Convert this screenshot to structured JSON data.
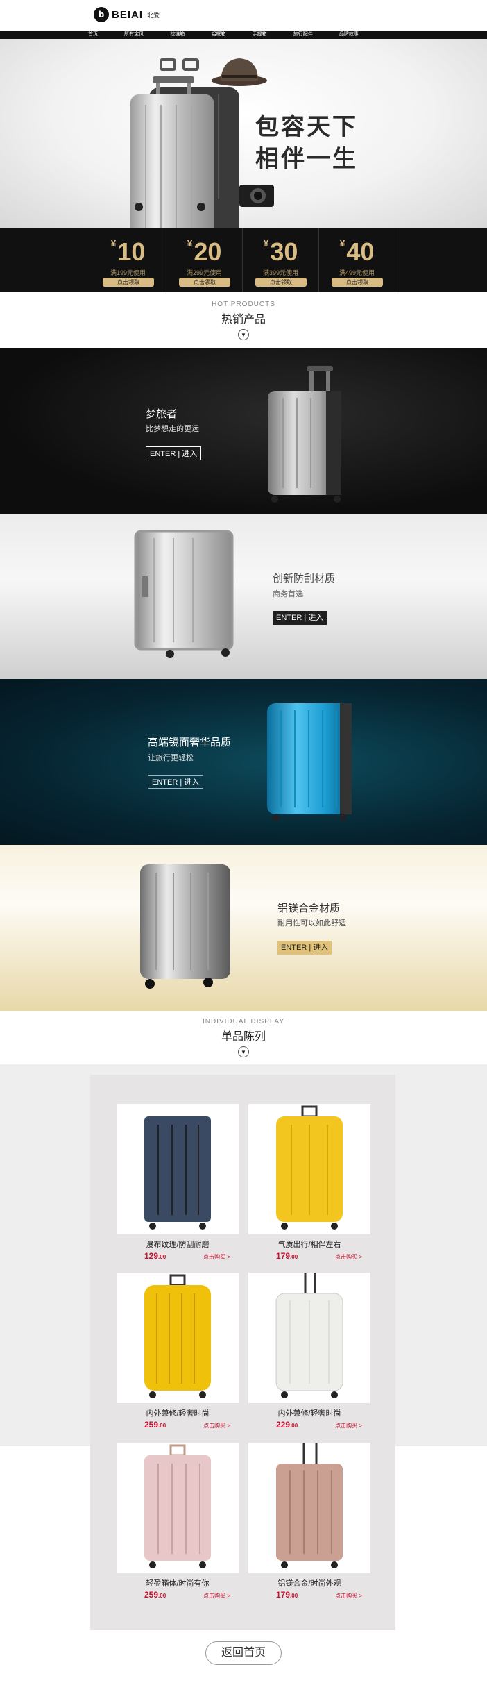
{
  "brand": {
    "logo_text": "BEIAI",
    "logo_sub": "北爱"
  },
  "nav": [
    "首页",
    "所有宝贝",
    "拉链箱",
    "铝框箱",
    "手提箱",
    "旅行配件",
    "品牌故事"
  ],
  "hero": {
    "line1": "包容天下",
    "line2": "相伴一生"
  },
  "coupons": [
    {
      "amount": "10",
      "condition": "满199元使用",
      "button": "点击领取"
    },
    {
      "amount": "20",
      "condition": "满299元使用",
      "button": "点击领取"
    },
    {
      "amount": "30",
      "condition": "满399元使用",
      "button": "点击领取"
    },
    {
      "amount": "40",
      "condition": "满499元使用",
      "button": "点击领取"
    }
  ],
  "hot": {
    "en": "HOT PRODUCTS",
    "cn": "热销产品"
  },
  "banners": [
    {
      "title": "梦旅者",
      "sub": "比梦想走的更远",
      "enter": "ENTER",
      "go": "进入"
    },
    {
      "title": "创新防刮材质",
      "sub": "商务首选",
      "enter": "ENTER",
      "go": "进入"
    },
    {
      "title": "高端镜面奢华品质",
      "sub": "让旅行更轻松",
      "enter": "ENTER",
      "go": "进入"
    },
    {
      "title": "铝镁合金材质",
      "sub": "耐用性可以如此舒适",
      "enter": "ENTER",
      "go": "进入"
    }
  ],
  "single": {
    "en": "INDIVIDUAL DISPLAY",
    "cn": "单品陈列"
  },
  "products": [
    {
      "name": "瀑布纹理/防刮耐磨",
      "price": "129",
      "decimal": ".00",
      "buy": "点击购买 >",
      "color": "#3b4a63"
    },
    {
      "name": "气质出行/相伴左右",
      "price": "179",
      "decimal": ".00",
      "buy": "点击购买 >",
      "color": "#f2c51f"
    },
    {
      "name": "内外兼修/轻奢时尚",
      "price": "259",
      "decimal": ".00",
      "buy": "点击购买 >",
      "color": "#f0c10a"
    },
    {
      "name": "内外兼修/轻奢时尚",
      "price": "229",
      "decimal": ".00",
      "buy": "点击购买 >",
      "color": "#eeeeea"
    },
    {
      "name": "轻盈箱体/时尚有你",
      "price": "259",
      "decimal": ".00",
      "buy": "点击购买 >",
      "color": "#e8c7c8"
    },
    {
      "name": "铝镁合金/时尚外观",
      "price": "179",
      "decimal": ".00",
      "buy": "点击购买 >",
      "color": "#caa092"
    }
  ],
  "back": "返回首页"
}
